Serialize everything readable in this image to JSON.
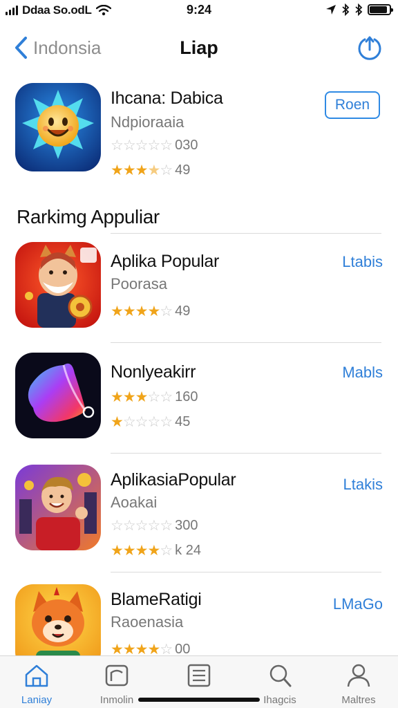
{
  "status_bar": {
    "carrier": "Ddaa So.odL",
    "time": "9:24"
  },
  "nav": {
    "back_label": "Indonsia",
    "title": "Liap"
  },
  "featured": {
    "name": "Ihcana: Dabica",
    "subtitle": "Ndpioraaia",
    "rating_count_1": "030",
    "rating_count_2": "49",
    "stars_1": 0,
    "stars_2": 3.5,
    "action": "Roen"
  },
  "section": {
    "title": "Rarkimg Appuliar"
  },
  "apps": [
    {
      "name": "Aplika Popular",
      "subtitle": "Poorasa",
      "stars": 4,
      "count": "49",
      "action": "Ltabis"
    },
    {
      "name": "Nonlyeakirr",
      "rating_a_stars": 3,
      "rating_a": "160",
      "rating_b_stars": 1,
      "rating_b": "45",
      "action": "Mabls"
    },
    {
      "name": "AplikasiaPopular",
      "subtitle": "Aoakai",
      "rating_a_stars": 0,
      "rating_a": "300",
      "rating_b_stars": 4,
      "rating_b": "k 24",
      "action": "Ltakis"
    },
    {
      "name": "BlameRatigi",
      "subtitle": "Raoenasia",
      "stars": 4,
      "count": "00",
      "action": "LMaGo"
    }
  ],
  "tabbar": {
    "tabs": [
      {
        "label": "Laniay",
        "icon": "house-icon"
      },
      {
        "label": "Inmolin",
        "icon": "apps-icon"
      },
      {
        "label": "",
        "icon": "list-icon"
      },
      {
        "label": "Ihagcis",
        "icon": "search-icon"
      },
      {
        "label": "Maltres",
        "icon": "person-icon"
      }
    ]
  },
  "colors": {
    "accent": "#2f7fd8",
    "star": "#f0a41a"
  }
}
